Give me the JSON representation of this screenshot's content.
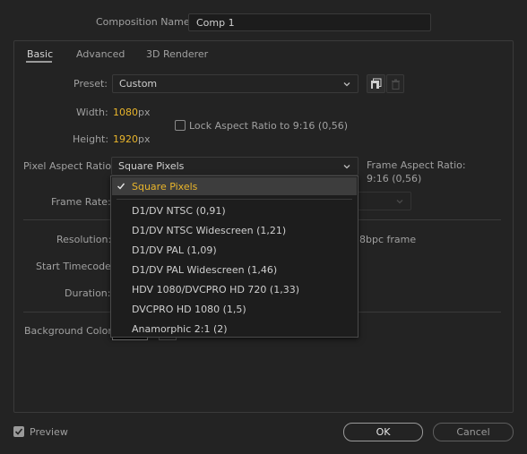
{
  "composition": {
    "name_label": "Composition Name:",
    "name_value": "Comp 1"
  },
  "tabs": [
    {
      "label": "Basic"
    },
    {
      "label": "Advanced"
    },
    {
      "label": "3D Renderer"
    }
  ],
  "preset": {
    "label": "Preset:",
    "value": "Custom"
  },
  "width": {
    "label": "Width:",
    "value": "1080",
    "unit": "px"
  },
  "height": {
    "label": "Height:",
    "value": "1920",
    "unit": "px"
  },
  "lock_aspect": {
    "label": "Lock Aspect Ratio to 9:16 (0,56)",
    "checked": false
  },
  "pixel_aspect": {
    "label": "Pixel Aspect Ratio:",
    "value": "Square Pixels"
  },
  "frame_aspect": {
    "label": "Frame Aspect Ratio:",
    "value": "9:16 (0,56)"
  },
  "frame_rate": {
    "label": "Frame Rate:"
  },
  "resolution": {
    "label": "Resolution:",
    "suffix": "8bpc frame"
  },
  "start_timecode": {
    "label": "Start Timecode:"
  },
  "duration": {
    "label": "Duration:"
  },
  "background_color": {
    "label": "Background Color:"
  },
  "dropdown": {
    "selected": "Square Pixels",
    "items": [
      "D1/DV NTSC (0,91)",
      "D1/DV NTSC Widescreen (1,21)",
      "D1/DV PAL (1,09)",
      "D1/DV PAL Widescreen (1,46)",
      "HDV 1080/DVCPRO HD 720 (1,33)",
      "DVCPRO HD 1080 (1,5)",
      "Anamorphic 2:1 (2)"
    ]
  },
  "preview": {
    "label": "Preview",
    "checked": true
  },
  "buttons": {
    "ok": "OK",
    "cancel": "Cancel"
  },
  "colors": {
    "accent": "#e9b52b",
    "background": "#232323",
    "selected_row": "#3d3d3d"
  }
}
